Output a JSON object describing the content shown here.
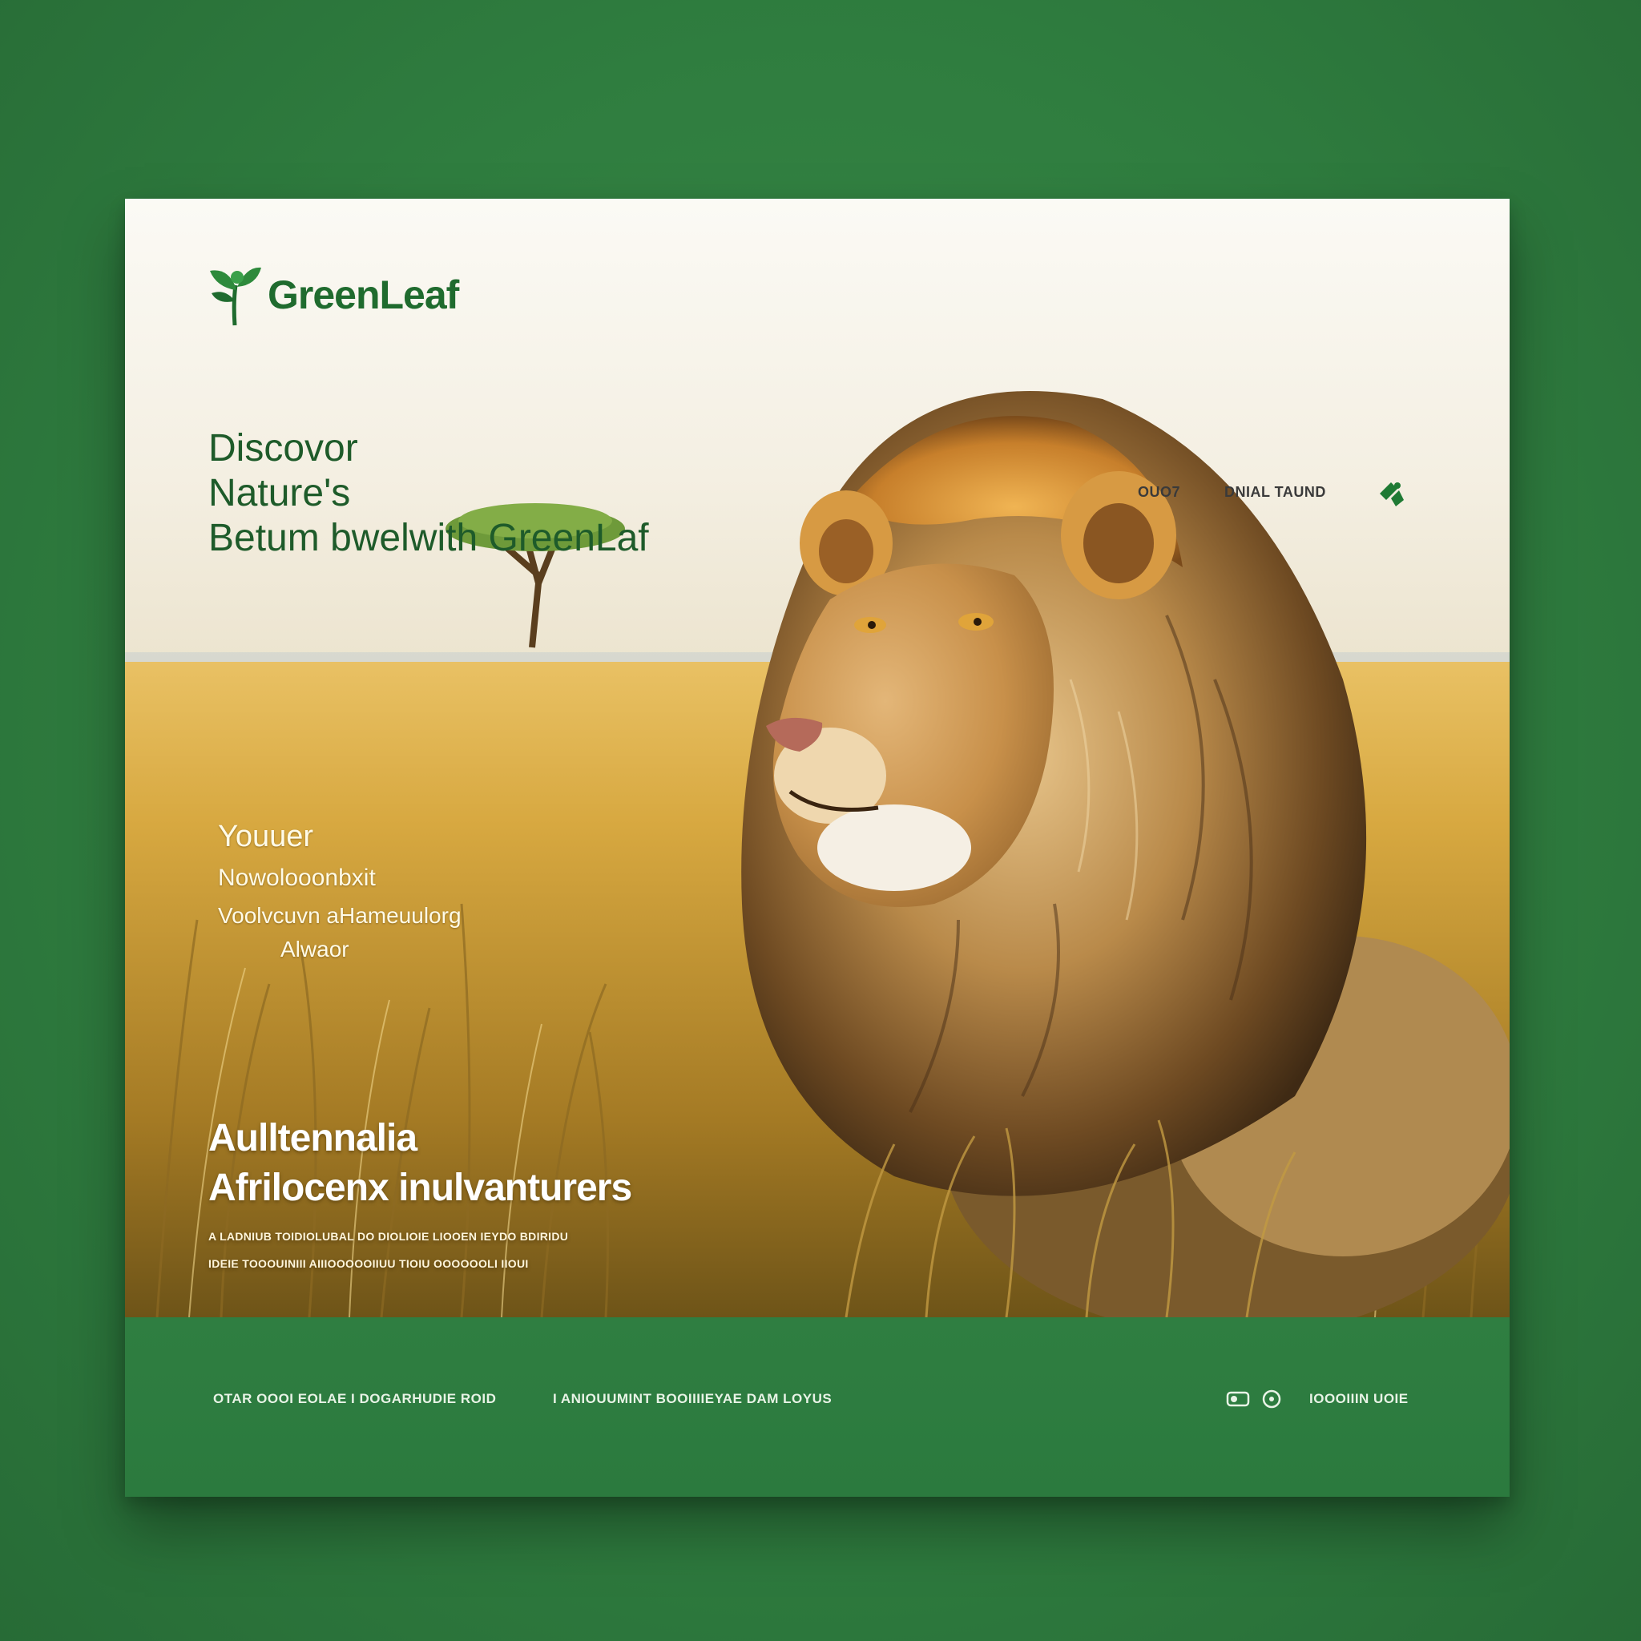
{
  "brand": {
    "name": "GreenLeaf",
    "color": "#1f6b2e"
  },
  "nav": {
    "items": [
      {
        "label": "OUO7"
      },
      {
        "label": "DNIAL TAUND"
      }
    ],
    "icon": "puzzle-leaf-icon"
  },
  "hero": {
    "headline": [
      "Discovor",
      "Nature's",
      "Betum bwelwith GreenLaf"
    ],
    "subtitle": [
      "Youuer",
      "Nowolooonbxit",
      "Voolvcuvn aHameuulorg",
      "Alwaor"
    ],
    "feature_title": [
      "Aulltennalia",
      "Afrilocenx inulvanturers"
    ],
    "feature_lines": [
      "A LADNIUB TOIDIOLUBAL DO DIOLIOIE LIOOEN IEYDO BDIRIDU",
      "IDEIE TOOOUINIII AIIIOOOOOIIUU TIOIU OOOOOOLI    IIOUI"
    ],
    "scene": "lion-in-savanna"
  },
  "footer": {
    "left_text": "OTAR OOOI  EOLAE I DOGARHUDIE ROID",
    "middle_text": "I ANIOUUMINT BOOIIIIEYAE DAM LOYUS",
    "right_text": "IOOOIIIN UOIE",
    "icons": [
      "toggle-icon",
      "circle-icon"
    ]
  },
  "colors": {
    "page_background": "#2f7d3f",
    "footer_background": "#2f7e41",
    "headline": "#1e5b2a"
  }
}
